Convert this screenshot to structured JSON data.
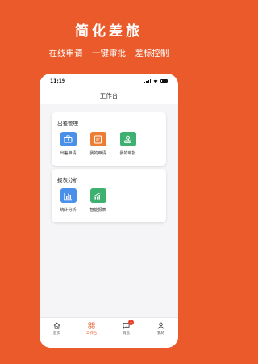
{
  "promo": {
    "title": "简化差旅",
    "subtitle": [
      "在线申请",
      "一键审批",
      "差标控制"
    ]
  },
  "status_bar": {
    "time": "11:19"
  },
  "nav": {
    "title": "工作台"
  },
  "sections": [
    {
      "title": "出差管理",
      "items": [
        {
          "label": "出差申请",
          "icon": "suitcase-icon",
          "color": "#4a8fe8"
        },
        {
          "label": "我的申请",
          "icon": "document-icon",
          "color": "#ee7d34"
        },
        {
          "label": "我的审批",
          "icon": "stamp-icon",
          "color": "#3eb070"
        }
      ]
    },
    {
      "title": "报表分析",
      "items": [
        {
          "label": "统计分析",
          "icon": "bar-chart-icon",
          "color": "#4a8fe8"
        },
        {
          "label": "智能报表",
          "icon": "trend-chart-icon",
          "color": "#3eb070"
        }
      ]
    }
  ],
  "tabbar": {
    "items": [
      {
        "label": "首页",
        "icon": "home-icon"
      },
      {
        "label": "工作台",
        "icon": "grid-icon",
        "active": true
      },
      {
        "label": "消息",
        "icon": "message-icon",
        "badge": "1"
      },
      {
        "label": "我的",
        "icon": "user-icon"
      }
    ]
  },
  "colors": {
    "background": "#ea5a2a",
    "accent": "#ea5a2a"
  }
}
